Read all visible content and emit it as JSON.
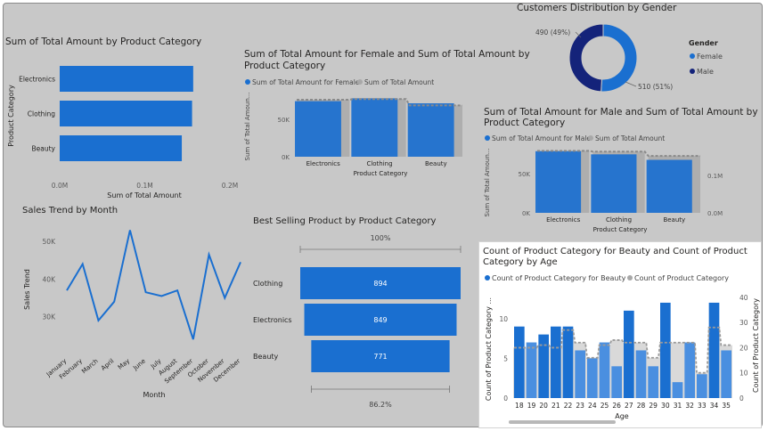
{
  "colors": {
    "primary": "#1a6fd0",
    "secondary": "#b0b0b0",
    "dark_navy": "#14237a",
    "mid_blue": "#4a8fe0",
    "axis_text": "#5a5a5a",
    "title_text": "#252423"
  },
  "visuals": {
    "category_bar": {
      "title": "Sum of Total Amount by Product Category",
      "ylabel": "Product Category",
      "xlabel": "Sum of Total Amount"
    },
    "female_combo": {
      "title_line1": "Sum of Total Amount for Female and Sum of Total Amount by",
      "title_line2": "Product Category",
      "legend_series1": "Sum of Total Amount for Female",
      "legend_series2": "Sum of Total Amount",
      "ylabel": "Sum of Total Amoun...",
      "xlabel": "Product Category"
    },
    "gender_donut": {
      "title": "Customers Distribution by Gender",
      "legend_title": "Gender",
      "legend_female": "Female",
      "legend_male": "Male",
      "label_male": "490 (49%)",
      "label_female": "510 (51%)"
    },
    "male_combo": {
      "title_line1": "Sum of Total Amount for Male and Sum of Total Amount by",
      "title_line2": "Product Category",
      "legend_series1": "Sum of Total Amount for Male",
      "legend_series2": "Sum of Total Amount",
      "ylabel": "Sum of Total Amoun...",
      "xlabel": "Product Category"
    },
    "sales_trend": {
      "title": "Sales Trend by Month",
      "ylabel": "Sales Trend",
      "xlabel": "Month"
    },
    "funnel": {
      "title": "Best Selling Product by Product Category",
      "top_pct": "100%",
      "bottom_pct": "86.2%"
    },
    "age_combo": {
      "title_line1": "Count of Product Category for Beauty and Count of Product",
      "title_line2": "Category by Age",
      "legend_series1": "Count of Product Category for Beauty",
      "legend_series2": "Count of Product Category",
      "ylabel_left": "Count of Product Category ...",
      "ylabel_right": "Count of Product Category",
      "xlabel": "Age"
    }
  },
  "chart_data": [
    {
      "id": "category_bar",
      "type": "bar",
      "orientation": "horizontal",
      "title": "Sum of Total Amount by Product Category",
      "xlabel": "Sum of Total Amount",
      "ylabel": "Product Category",
      "categories": [
        "Electronics",
        "Clothing",
        "Beauty"
      ],
      "values": [
        156905,
        155580,
        143515
      ],
      "xlim": [
        0,
        200000
      ],
      "xticks": [
        "0.0M",
        "0.1M",
        "0.2M"
      ]
    },
    {
      "id": "female_combo",
      "type": "bar",
      "title": "Sum of Total Amount for Female and Sum of Total Amount by Product Category",
      "xlabel": "Product Category",
      "ylabel": "Sum of Total Amoun...",
      "categories": [
        "Electronics",
        "Clothing",
        "Beauty"
      ],
      "series": [
        {
          "name": "Sum of Total Amount for Female",
          "values": [
            78000,
            82000,
            75000
          ]
        },
        {
          "name": "Sum of Total Amount",
          "values": [
            80000,
            81000,
            72000
          ]
        }
      ],
      "yticks": [
        "0K",
        "50K"
      ]
    },
    {
      "id": "gender_donut",
      "type": "pie",
      "title": "Customers Distribution by Gender",
      "legend_title": "Gender",
      "categories": [
        "Female",
        "Male"
      ],
      "values": [
        510,
        490
      ],
      "labels": [
        "510 (51%)",
        "490 (49%)"
      ]
    },
    {
      "id": "male_combo",
      "type": "bar",
      "title": "Sum of Total Amount for Male and Sum of Total Amount by Product Category",
      "xlabel": "Product Category",
      "ylabel": "Sum of Total Amoun...",
      "categories": [
        "Electronics",
        "Clothing",
        "Beauty"
      ],
      "series": [
        {
          "name": "Sum of Total Amount for Male",
          "values": [
            78000,
            74000,
            67000
          ]
        },
        {
          "name": "Sum of Total Amount",
          "values": [
            157000,
            155000,
            144000
          ]
        }
      ],
      "yticks_left": [
        "0K",
        "50K"
      ],
      "yticks_right": [
        "0.0M",
        "0.1M"
      ]
    },
    {
      "id": "sales_trend",
      "type": "line",
      "title": "Sales Trend by Month",
      "xlabel": "Month",
      "ylabel": "Sales Trend",
      "categories": [
        "January",
        "February",
        "March",
        "April",
        "May",
        "June",
        "July",
        "August",
        "September",
        "October",
        "November",
        "December"
      ],
      "values": [
        37000,
        44000,
        29000,
        34000,
        53000,
        36500,
        35500,
        37000,
        24000,
        46500,
        35000,
        44500
      ],
      "ylim": [
        20000,
        55000
      ],
      "yticks": [
        "30K",
        "40K",
        "50K"
      ]
    },
    {
      "id": "funnel",
      "type": "bar",
      "subtype": "funnel",
      "title": "Best Selling Product by Product Category",
      "categories": [
        "Clothing",
        "Electronics",
        "Beauty"
      ],
      "values": [
        894,
        849,
        771
      ],
      "top_label": "100%",
      "bottom_label": "86.2%"
    },
    {
      "id": "age_combo",
      "type": "bar",
      "title": "Count of Product Category for Beauty and Count of Product Category by Age",
      "xlabel": "Age",
      "ylabel": "Count of Product Category ...",
      "ylabel_right": "Count of Product Category",
      "categories": [
        "18",
        "19",
        "20",
        "21",
        "22",
        "23",
        "24",
        "25",
        "26",
        "27",
        "28",
        "29",
        "30",
        "31",
        "32",
        "33",
        "34",
        "35"
      ],
      "series": [
        {
          "name": "Count of Product Category for Beauty",
          "values": [
            9,
            7,
            8,
            9,
            9,
            6,
            5,
            7,
            4,
            11,
            6,
            4,
            12,
            2,
            7,
            3,
            12,
            6
          ]
        },
        {
          "name": "Count of Product Category",
          "values": [
            20,
            20,
            21,
            20,
            27,
            22,
            16,
            21,
            23,
            22,
            22,
            16,
            22,
            22,
            22,
            10,
            28,
            21
          ]
        }
      ],
      "yticks_left": [
        "0",
        "5",
        "10"
      ],
      "yticks_right": [
        "0",
        "10",
        "20",
        "30",
        "40"
      ]
    }
  ]
}
